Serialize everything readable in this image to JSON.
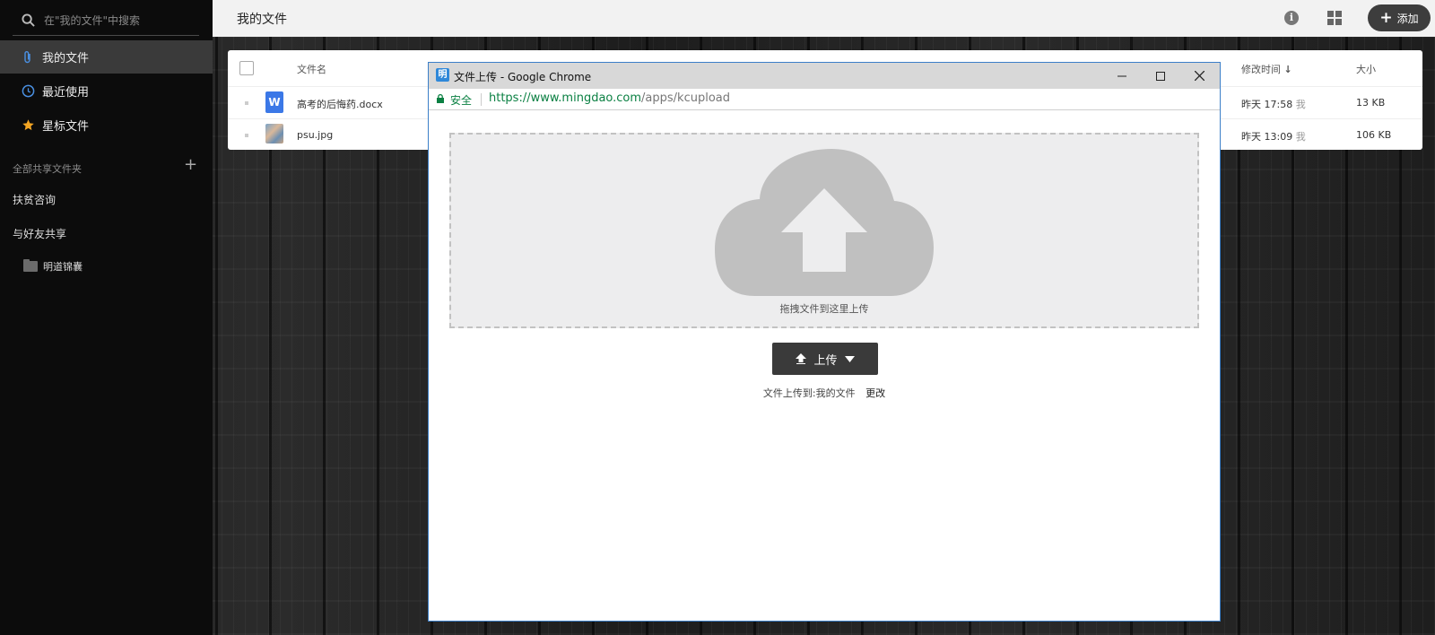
{
  "sidebar": {
    "search_placeholder": "在\"我的文件\"中搜索",
    "nav": [
      {
        "label": "我的文件",
        "icon": "paperclip-icon",
        "active": true
      },
      {
        "label": "最近使用",
        "icon": "clock-icon",
        "active": false
      },
      {
        "label": "星标文件",
        "icon": "star-icon",
        "active": false
      }
    ],
    "section_title": "全部共享文件夹",
    "section_add": "+",
    "shared": [
      {
        "label": "扶贫咨询"
      },
      {
        "label": "与好友共享"
      }
    ],
    "folder": {
      "label": "明道锦囊",
      "icon": "folder-icon"
    }
  },
  "header": {
    "title": "我的文件",
    "info_glyph": "i",
    "info_icon": "info-icon",
    "grid_icon": "grid-view-icon",
    "add_label": "添加",
    "add_plus": "+"
  },
  "file_table": {
    "headers": {
      "name": "文件名",
      "modified": "修改时间",
      "sort_arrow": "↓",
      "size": "大小"
    },
    "rows": [
      {
        "name": "高考的后悔药.docx",
        "icon": "word-doc-icon",
        "icon_text": "W",
        "modified": "昨天 17:58",
        "modified_by": "我",
        "size": "13 KB"
      },
      {
        "name": "psu.jpg",
        "icon": "image-thumbnail-icon",
        "modified": "昨天 13:09",
        "modified_by": "我",
        "size": "106 KB"
      }
    ]
  },
  "chrome_popup": {
    "favicon_text": "明",
    "window_title": "文件上传 - Google Chrome",
    "controls": {
      "minimize": "–",
      "maximize": "☐",
      "close": "✕"
    },
    "secure_label": "安全",
    "url_host": "https://www.mingdao.com",
    "url_path": "/apps/kcupload",
    "dropzone_text": "拖拽文件到这里上传",
    "upload_button": "上传",
    "upload_note": "文件上传到:我的文件",
    "change_link": "更改"
  },
  "colors": {
    "sidebar_bg": "#0c0c0c",
    "active_item_bg": "#3a3a3a",
    "star": "#f5a623",
    "clock": "#4a90e2",
    "paperclip": "#4a90e2",
    "secure_green": "#0b8043",
    "word_blue": "#3b78e7",
    "cloud_gray": "#c0c0c0",
    "upload_btn_bg": "#3a3a3a"
  }
}
